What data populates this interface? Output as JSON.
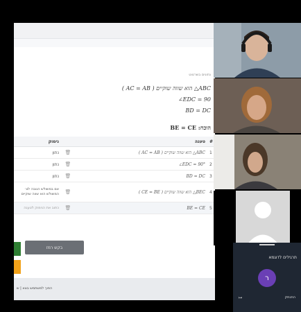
{
  "problem": {
    "given_label": "נתונים בשרטוט",
    "given_1": "( AC = AB ) הוא שווה שוקיים △ABC",
    "given_2": "∠EDC = 90",
    "given_3": "BD = DC",
    "prove": "BE = CE :הוכח"
  },
  "table": {
    "col_explanation": "נימוק",
    "col_claim": "טענה",
    "col_num": "#",
    "rows": [
      {
        "num": "1",
        "claim": "( AC = AB ) הוא שווה שוקיים △ABC",
        "explanation": "נתון"
      },
      {
        "num": "2",
        "claim": "∠EDC = 90°",
        "explanation": "נתון"
      },
      {
        "num": "3",
        "claim": "BD = DC",
        "explanation": "נתון"
      },
      {
        "num": "4",
        "claim": "( CE = BE ) הוא שווה שוקיים △BEC",
        "explanation": "אם במשולש הגובה לצ׳ המשולש הוא שווה שוקיים"
      },
      {
        "num": "5",
        "claim": "BE = CE",
        "explanation": "כתוב את הנימוק לטענה"
      }
    ]
  },
  "buttons": {
    "hint": "בקש רמז"
  },
  "footer": {
    "text": "הפוך למשתמש בצא  |  ש"
  },
  "side_panel": {
    "title": "תרגילים לדוגמא",
    "avatar_letter": "ר",
    "logout": "התנתק"
  },
  "colors": {
    "green_button": "#2e7d32",
    "orange_button": "#f2a21a",
    "avatar_purple": "#6a3fb5",
    "panel_bg": "#1f2733"
  }
}
